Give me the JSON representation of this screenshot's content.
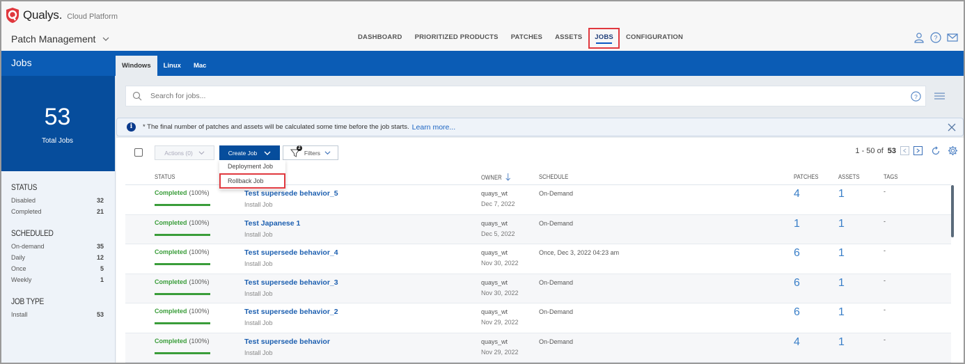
{
  "brand": {
    "name": "Qualys.",
    "sub": "Cloud Platform",
    "logo_color": "#e0383e"
  },
  "module": {
    "label": "Patch Management"
  },
  "nav": {
    "items": [
      {
        "label": "DASHBOARD",
        "active": false
      },
      {
        "label": "PRIORITIZED PRODUCTS",
        "active": false
      },
      {
        "label": "PATCHES",
        "active": false
      },
      {
        "label": "ASSETS",
        "active": false
      },
      {
        "label": "JOBS",
        "active": true
      },
      {
        "label": "CONFIGURATION",
        "active": false
      }
    ],
    "icons": [
      "user-icon",
      "help-icon",
      "mail-icon"
    ]
  },
  "band": {
    "title": "Jobs",
    "os_tabs": [
      {
        "label": "Windows",
        "active": true
      },
      {
        "label": "Linux",
        "active": false
      },
      {
        "label": "Mac",
        "active": false
      }
    ]
  },
  "sidebar": {
    "total": {
      "value": "53",
      "label": "Total Jobs"
    },
    "facets": [
      {
        "title": "STATUS",
        "rows": [
          {
            "label": "Disabled",
            "count": "32"
          },
          {
            "label": "Completed",
            "count": "21"
          }
        ]
      },
      {
        "title": "SCHEDULED",
        "rows": [
          {
            "label": "On-demand",
            "count": "35"
          },
          {
            "label": "Daily",
            "count": "12"
          },
          {
            "label": "Once",
            "count": "5"
          },
          {
            "label": "Weekly",
            "count": "1"
          }
        ]
      },
      {
        "title": "JOB TYPE",
        "rows": [
          {
            "label": "Install",
            "count": "53"
          }
        ]
      }
    ]
  },
  "search": {
    "placeholder": "Search for jobs..."
  },
  "banner": {
    "text": "* The final number of patches and assets will be calculated some time before the job starts.",
    "link": "Learn more..."
  },
  "toolbar": {
    "actions_label": "Actions (0)",
    "create_label": "Create Job",
    "filters_label": "Filters",
    "filters_count": "2",
    "pager_range": "1 - 50 of",
    "pager_total": "53"
  },
  "create_menu": {
    "items": [
      {
        "label": "Deployment Job",
        "highlighted": false
      },
      {
        "label": "Rollback Job",
        "highlighted": true
      }
    ]
  },
  "table": {
    "columns": {
      "status": "STATUS",
      "owner": "OWNER",
      "schedule": "SCHEDULE",
      "patches": "PATCHES",
      "assets": "ASSETS",
      "tags": "TAGS"
    },
    "rows": [
      {
        "status": "Completed",
        "percent": "(100%)",
        "progress": 1.0,
        "name": "Test supersede behavior_5",
        "type": "Install Job",
        "owner": "quays_wt",
        "date": "Dec 7, 2022",
        "schedule": "On-Demand",
        "patches": "4",
        "assets": "1",
        "tags": "-"
      },
      {
        "status": "Completed",
        "percent": "(100%)",
        "progress": 1.0,
        "name": "Test Japanese 1",
        "type": "Install Job",
        "owner": "quays_wt",
        "date": "Dec 5, 2022",
        "schedule": "On-Demand",
        "patches": "1",
        "assets": "1",
        "tags": "-"
      },
      {
        "status": "Completed",
        "percent": "(100%)",
        "progress": 1.0,
        "name": "Test supersede behavior_4",
        "type": "Install Job",
        "owner": "quays_wt",
        "date": "Nov 30, 2022",
        "schedule": "Once, Dec 3, 2022 04:23 am",
        "patches": "6",
        "assets": "1",
        "tags": "-"
      },
      {
        "status": "Completed",
        "percent": "(100%)",
        "progress": 1.0,
        "name": "Test supersede behavior_3",
        "type": "Install Job",
        "owner": "quays_wt",
        "date": "Nov 30, 2022",
        "schedule": "On-Demand",
        "patches": "6",
        "assets": "1",
        "tags": "-"
      },
      {
        "status": "Completed",
        "percent": "(100%)",
        "progress": 1.0,
        "name": "Test supersede behavior_2",
        "type": "Install Job",
        "owner": "quays_wt",
        "date": "Nov 29, 2022",
        "schedule": "On-Demand",
        "patches": "6",
        "assets": "1",
        "tags": "-"
      },
      {
        "status": "Completed",
        "percent": "(100%)",
        "progress": 1.0,
        "name": "Test supersede behavior",
        "type": "Install Job",
        "owner": "quays_wt",
        "date": "Nov 29, 2022",
        "schedule": "On-Demand",
        "patches": "4",
        "assets": "1",
        "tags": "-"
      }
    ]
  }
}
